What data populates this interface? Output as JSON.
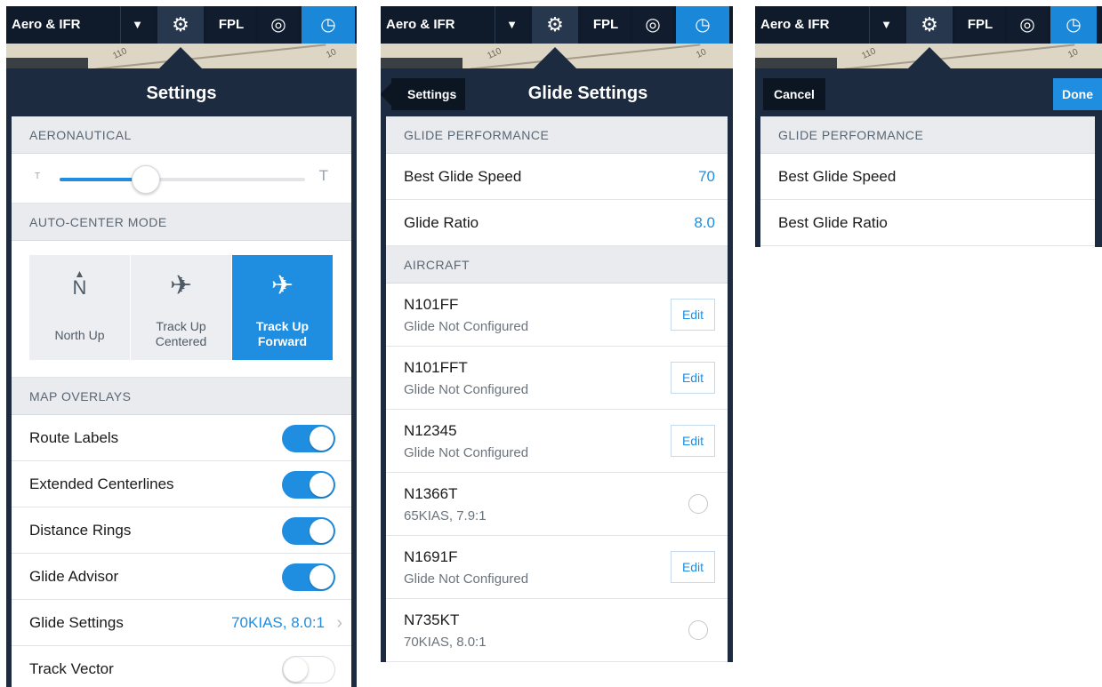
{
  "colors": {
    "panel_bg": "#1c2b3f",
    "topbar_bg": "#0f1b2b",
    "accent": "#1f8ee0",
    "section_bg": "#e9ebee"
  },
  "topbar": {
    "layer_label": "Aero & IFR",
    "dropdown_glyph": "▼",
    "gear_glyph": "⚙",
    "fpl_label": "FPL",
    "globe_glyph": "◎",
    "gauge_glyph": "◷",
    "icons": [
      "dropdown-arrow-icon",
      "gear-icon",
      "globe-icon",
      "gauge-icon"
    ]
  },
  "map": {
    "label_a": "110",
    "label_b": "10"
  },
  "settings": {
    "title": "Settings",
    "aeronautical_header": "AERONAUTICAL",
    "text_size_min": "T",
    "text_size_max": "T",
    "text_size_level": 0.35,
    "auto_center_header": "AUTO-CENTER MODE",
    "modes": [
      {
        "icon": "north-up-icon",
        "glyph": "N",
        "arrow": "▲",
        "label_line1": "North Up",
        "label_line2": "",
        "selected": false
      },
      {
        "icon": "airplane-icon",
        "glyph": "✈",
        "label_line1": "Track Up",
        "label_line2": "Centered",
        "selected": false
      },
      {
        "icon": "airplane-icon",
        "glyph": "✈",
        "label_line1": "Track Up",
        "label_line2": "Forward",
        "selected": true
      }
    ],
    "map_overlays_header": "MAP OVERLAYS",
    "overlays": [
      {
        "label": "Route Labels",
        "on": true
      },
      {
        "label": "Extended Centerlines",
        "on": true
      },
      {
        "label": "Distance Rings",
        "on": true
      },
      {
        "label": "Glide Advisor",
        "on": true
      }
    ],
    "glide_settings": {
      "label": "Glide Settings",
      "value": "70KIAS, 8.0:1",
      "chevron": "›"
    },
    "track_vector": {
      "label": "Track Vector",
      "on": false
    }
  },
  "glide": {
    "back_label": "Settings",
    "title": "Glide Settings",
    "performance_header": "GLIDE PERFORMANCE",
    "best_glide_speed_label": "Best Glide Speed",
    "best_glide_speed_value": "70",
    "glide_ratio_label": "Glide Ratio",
    "glide_ratio_value": "8.0",
    "aircraft_header": "AIRCRAFT",
    "edit_label": "Edit",
    "aircraft": [
      {
        "tail": "N101FF",
        "detail": "Glide Not Configured",
        "control": "edit"
      },
      {
        "tail": "N101FFT",
        "detail": "Glide Not Configured",
        "control": "edit"
      },
      {
        "tail": "N12345",
        "detail": "Glide Not Configured",
        "control": "edit"
      },
      {
        "tail": "N1366T",
        "detail": "65KIAS, 7.9:1",
        "control": "radio"
      },
      {
        "tail": "N1691F",
        "detail": "Glide Not Configured",
        "control": "edit"
      },
      {
        "tail": "N735KT",
        "detail": "70KIAS, 8.0:1",
        "control": "radio"
      }
    ]
  },
  "edit": {
    "cancel_label": "Cancel",
    "done_label": "Done",
    "performance_header": "GLIDE PERFORMANCE",
    "best_glide_speed_label": "Best Glide Speed",
    "best_glide_ratio_label": "Best Glide Ratio"
  }
}
